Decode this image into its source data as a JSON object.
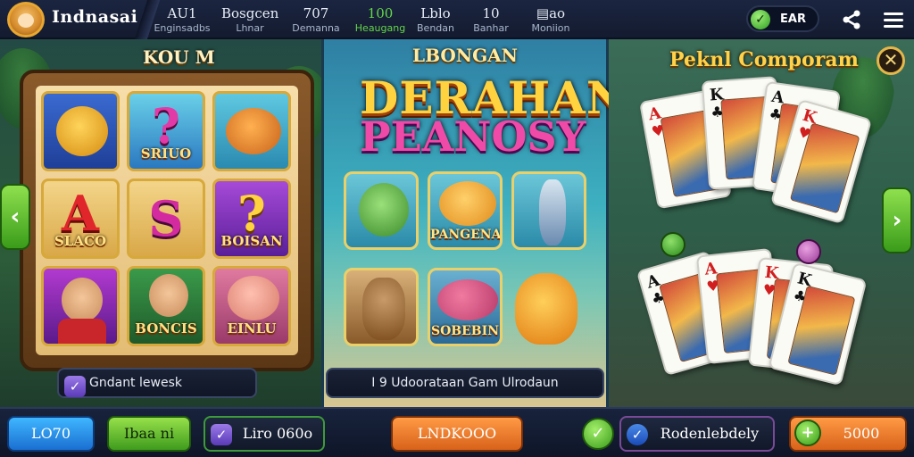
{
  "header": {
    "brand": "Indnasai",
    "stats": [
      {
        "value": "AU1",
        "label": "Enginsadbs"
      },
      {
        "value": "Bosgcen",
        "label": "Lhnar"
      },
      {
        "value": "707",
        "label": "Demanna"
      },
      {
        "value": "100",
        "label": "Heaugang"
      },
      {
        "value": "Lblo",
        "label": "Bendan"
      },
      {
        "value": "10",
        "label": "Banhar"
      },
      {
        "value": "▤ao",
        "label": "Moniion"
      }
    ],
    "status_label": "EAR",
    "colors": {
      "accent_green": "#63d64a",
      "bar_bg": "#141b30"
    }
  },
  "left_panel": {
    "title": "KOU M",
    "tiles": [
      {
        "caption": "",
        "glyph": ""
      },
      {
        "caption": "SRIUO",
        "glyph": "?"
      },
      {
        "caption": "",
        "glyph": ""
      },
      {
        "caption": "SLACO",
        "glyph": "A"
      },
      {
        "caption": "",
        "glyph": "S"
      },
      {
        "caption": "BOISAN",
        "glyph": "?"
      },
      {
        "caption": "",
        "glyph": ""
      },
      {
        "caption": "BONCIS",
        "glyph": ""
      },
      {
        "caption": "EINLU",
        "glyph": ""
      }
    ],
    "footer_label": "Gndant lewesk"
  },
  "middle_panel": {
    "subtitle": "LBONGAN",
    "logo_line1": "DERAHAN",
    "logo_line2": "PEANOSY",
    "tiles": [
      {
        "caption": ""
      },
      {
        "caption": "PANGENA"
      },
      {
        "caption": ""
      },
      {
        "caption": ""
      },
      {
        "caption": "SOBEBIN"
      },
      {
        "caption": ""
      }
    ],
    "footer_label": "I 9 Udoorataan Gam Ulrodaun"
  },
  "right_panel": {
    "title": "Peknl Comporam",
    "cards_top": [
      {
        "rank": "A",
        "suit": "♥",
        "color": "red"
      },
      {
        "rank": "K",
        "suit": "♣",
        "color": "blk"
      },
      {
        "rank": "A",
        "suit": "♣",
        "color": "blk"
      },
      {
        "rank": "K",
        "suit": "♥",
        "color": "red"
      }
    ],
    "cards_bottom": [
      {
        "rank": "A",
        "suit": "♣",
        "color": "blk"
      },
      {
        "rank": "A",
        "suit": "♥",
        "color": "red"
      },
      {
        "rank": "K",
        "suit": "♥",
        "color": "red"
      },
      {
        "rank": "K",
        "suit": "♣",
        "color": "blk"
      }
    ]
  },
  "bottom_bar": {
    "btn_1": "LO70",
    "btn_2": "Ibaa ni",
    "btn_3": "Liro 060o",
    "btn_4": "LNDKOOO",
    "btn_5": "Rodenlebdely",
    "btn_6": "5000"
  }
}
